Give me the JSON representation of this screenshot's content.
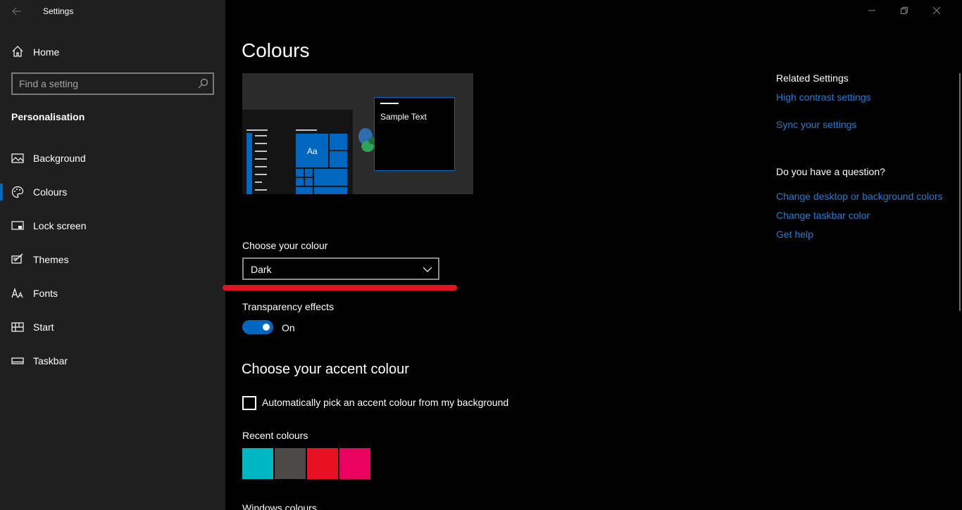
{
  "window": {
    "title": "Settings",
    "back_icon": "back-arrow-icon",
    "controls": [
      "minimize-icon",
      "restore-icon",
      "close-icon"
    ]
  },
  "sidebar": {
    "home_label": "Home",
    "search_placeholder": "Find a setting",
    "section_title": "Personalisation",
    "items": [
      {
        "label": "Background",
        "icon": "picture-icon"
      },
      {
        "label": "Colours",
        "icon": "palette-icon",
        "active": true
      },
      {
        "label": "Lock screen",
        "icon": "lock-screen-icon"
      },
      {
        "label": "Themes",
        "icon": "themes-icon"
      },
      {
        "label": "Fonts",
        "icon": "fonts-icon"
      },
      {
        "label": "Start",
        "icon": "start-icon"
      },
      {
        "label": "Taskbar",
        "icon": "taskbar-icon"
      }
    ]
  },
  "main": {
    "title": "Colours",
    "preview": {
      "tile_label": "Aa",
      "sample_text": "Sample Text"
    },
    "choose_colour": {
      "label": "Choose your colour",
      "value": "Dark"
    },
    "transparency": {
      "label": "Transparency effects",
      "state": "On",
      "on": true
    },
    "accent_heading": "Choose your accent colour",
    "auto_pick": {
      "label": "Automatically pick an accent colour from my background",
      "checked": false
    },
    "recent_colours": {
      "label": "Recent colours",
      "colors": [
        "#00b7c3",
        "#4c4a48",
        "#e81123",
        "#ea005e"
      ]
    },
    "windows_colours_label": "Windows colours"
  },
  "related": {
    "title": "Related Settings",
    "links": [
      "High contrast settings",
      "Sync your settings"
    ],
    "question_title": "Do you have a question?",
    "help_links": [
      "Change desktop or background colors",
      "Change taskbar color",
      "Get help"
    ]
  },
  "colors": {
    "accent": "#0067c0",
    "link": "#1f7ed6",
    "sidebar_bg": "#1f1f1f",
    "annotation": "#e0141e"
  }
}
